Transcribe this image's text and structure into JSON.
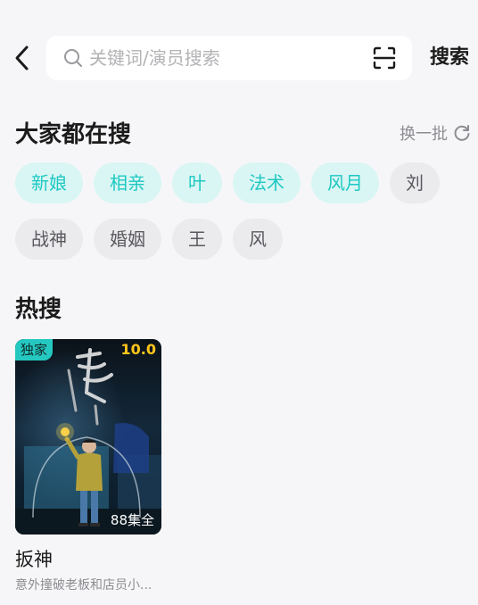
{
  "search": {
    "placeholder": "关键词/演员搜索",
    "submit_label": "搜索"
  },
  "trending": {
    "title": "大家都在搜",
    "refresh_label": "换一批",
    "row1": [
      "新娘",
      "相亲",
      "叶",
      "法术",
      "风月",
      "刘"
    ],
    "row2": [
      "战神",
      "婚姻",
      "王",
      "风"
    ]
  },
  "hot": {
    "title": "热搜",
    "items": [
      {
        "badge": "独家",
        "rating": "10.0",
        "episodes": "88集全",
        "title": "扳神",
        "description": "意外撞破老板和店员小..."
      }
    ]
  },
  "colors": {
    "background": "#f6f6f8",
    "accent": "#1ec8c2",
    "accent_bg": "#d9f6f4",
    "rating": "#ffc61a"
  },
  "icons": [
    "chevron-left-icon",
    "search-icon",
    "scan-icon",
    "refresh-icon"
  ]
}
